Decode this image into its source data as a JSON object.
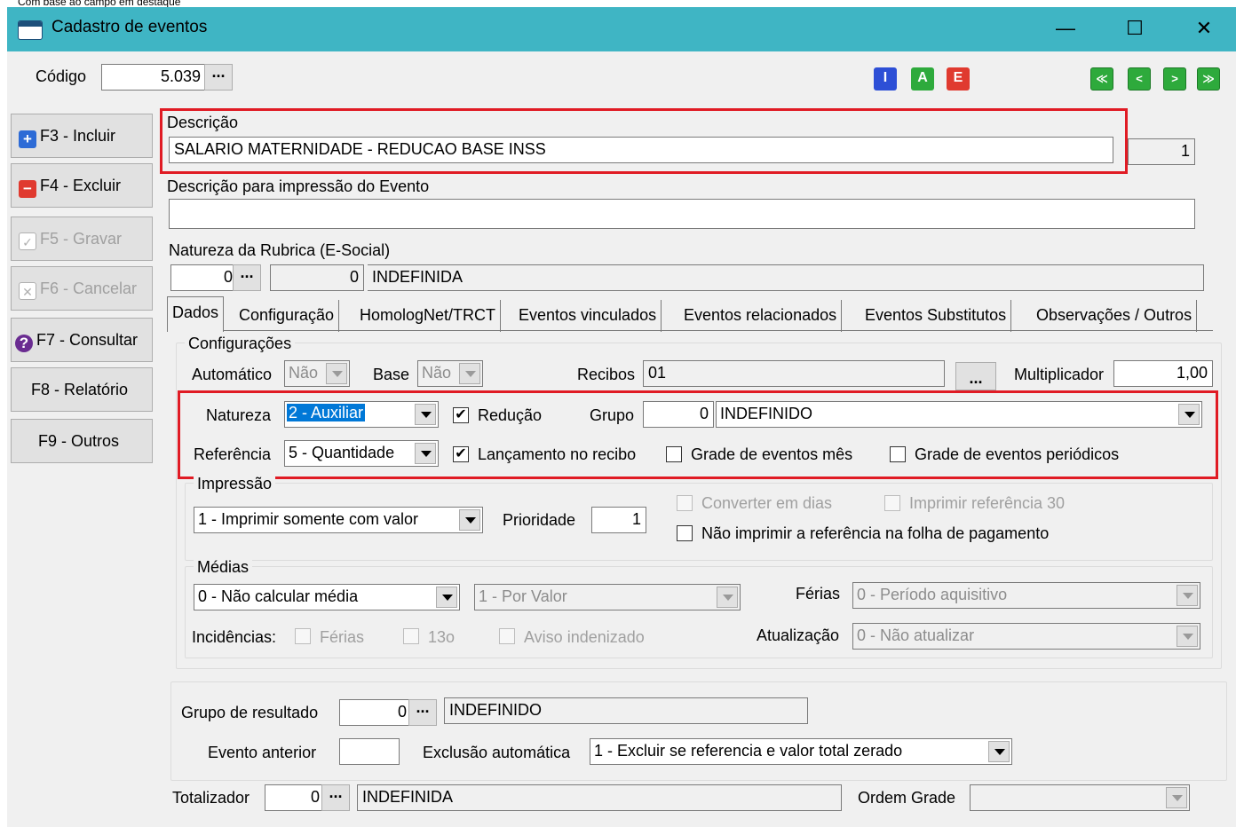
{
  "top_strip": "Com base ao campo em destaque",
  "window": {
    "title": "Cadastro de eventos",
    "minimize": "—",
    "maximize": "☐",
    "close": "✕"
  },
  "header": {
    "codigo_label": "Código",
    "codigo_value": "5.039",
    "ellipsis": "···",
    "iae": [
      "I",
      "A",
      "E"
    ],
    "nav": [
      "≪",
      "<",
      ">",
      "≫"
    ]
  },
  "sidebar": [
    {
      "label": "F3 - Incluir",
      "icon": "+",
      "color": "#2d6bd6",
      "enabled": true
    },
    {
      "label": "F4 - Excluir",
      "icon": "−",
      "color": "#e03a2f",
      "enabled": true
    },
    {
      "label": "F5 - Gravar",
      "icon": "✓",
      "color": "#b0b0b0",
      "enabled": false
    },
    {
      "label": "F6 - Cancelar",
      "icon": "✕",
      "color": "#b0b0b0",
      "enabled": false
    },
    {
      "label": "F7 - Consultar",
      "icon": "?",
      "color": "#6a2c91",
      "enabled": true
    },
    {
      "label": "F8 - Relatório",
      "icon": "",
      "color": "",
      "enabled": true
    },
    {
      "label": "F9 - Outros",
      "icon": "",
      "color": "",
      "enabled": true
    }
  ],
  "descricao": {
    "label": "Descrição",
    "value": "SALARIO MATERNIDADE - REDUCAO BASE INSS",
    "side_value": "1"
  },
  "descricao_impressao": {
    "label": "Descrição para impressão do Evento",
    "value": ""
  },
  "natureza_rubrica": {
    "label": "Natureza da Rubrica (E-Social)",
    "code": "0",
    "code2": "0",
    "text": "INDEFINIDA"
  },
  "tabs": [
    "Dados",
    "Configuração",
    "HomologNet/TRCT",
    "Eventos vinculados",
    "Eventos relacionados",
    "Eventos Substitutos",
    "Observações / Outros"
  ],
  "config": {
    "title": "Configurações",
    "automatico_label": "Automático",
    "automatico_value": "Não",
    "base_label": "Base",
    "base_value": "Não",
    "recibos_label": "Recibos",
    "recibos_value": "01",
    "recibos_btn": "...",
    "multiplicador_label": "Multiplicador",
    "multiplicador_value": "1,00",
    "natureza_label": "Natureza",
    "natureza_value": "2 - Auxiliar",
    "reducao_label": "Redução",
    "grupo_label": "Grupo",
    "grupo_code": "0",
    "grupo_value": "INDEFINIDO",
    "referencia_label": "Referência",
    "referencia_value": "5 - Quantidade",
    "lancamento_label": "Lançamento no recibo",
    "grade_mes_label": "Grade de eventos mês",
    "grade_periodicos_label": "Grade de eventos periódicos"
  },
  "impressao": {
    "title": "Impressão",
    "value": "1 - Imprimir somente com valor",
    "prioridade_label": "Prioridade",
    "prioridade_value": "1",
    "converter_label": "Converter em dias",
    "imprimir_ref_label": "Imprimir referência 30",
    "nao_imprimir_label": "Não imprimir a referência na folha de pagamento"
  },
  "medias": {
    "title": "Médias",
    "calc_value": "0 - Não calcular média",
    "por_value": "1 - Por Valor",
    "ferias_label": "Férias",
    "ferias_value": "0 - Período aquisitivo",
    "incidencias_label": "Incidências:",
    "inc_ferias": "Férias",
    "inc_13": "13o",
    "inc_aviso": "Aviso indenizado",
    "atualizacao_label": "Atualização",
    "atualizacao_value": "0 - Não atualizar"
  },
  "bottom": {
    "grupo_resultado_label": "Grupo de resultado",
    "grupo_resultado_code": "0",
    "grupo_resultado_text": "INDEFINIDO",
    "evento_anterior_label": "Evento anterior",
    "evento_anterior_value": "",
    "exclusao_label": "Exclusão automática",
    "exclusao_value": "1 - Excluir se referencia e valor total zerado",
    "totalizador_label": "Totalizador",
    "totalizador_code": "0",
    "totalizador_text": "INDEFINIDA",
    "ordem_grade_label": "Ordem Grade",
    "ordem_grade_value": ""
  },
  "colors": {
    "titlebar": "#3fb5c4",
    "highlight": "#e01b24",
    "selection": "#0078d7"
  }
}
